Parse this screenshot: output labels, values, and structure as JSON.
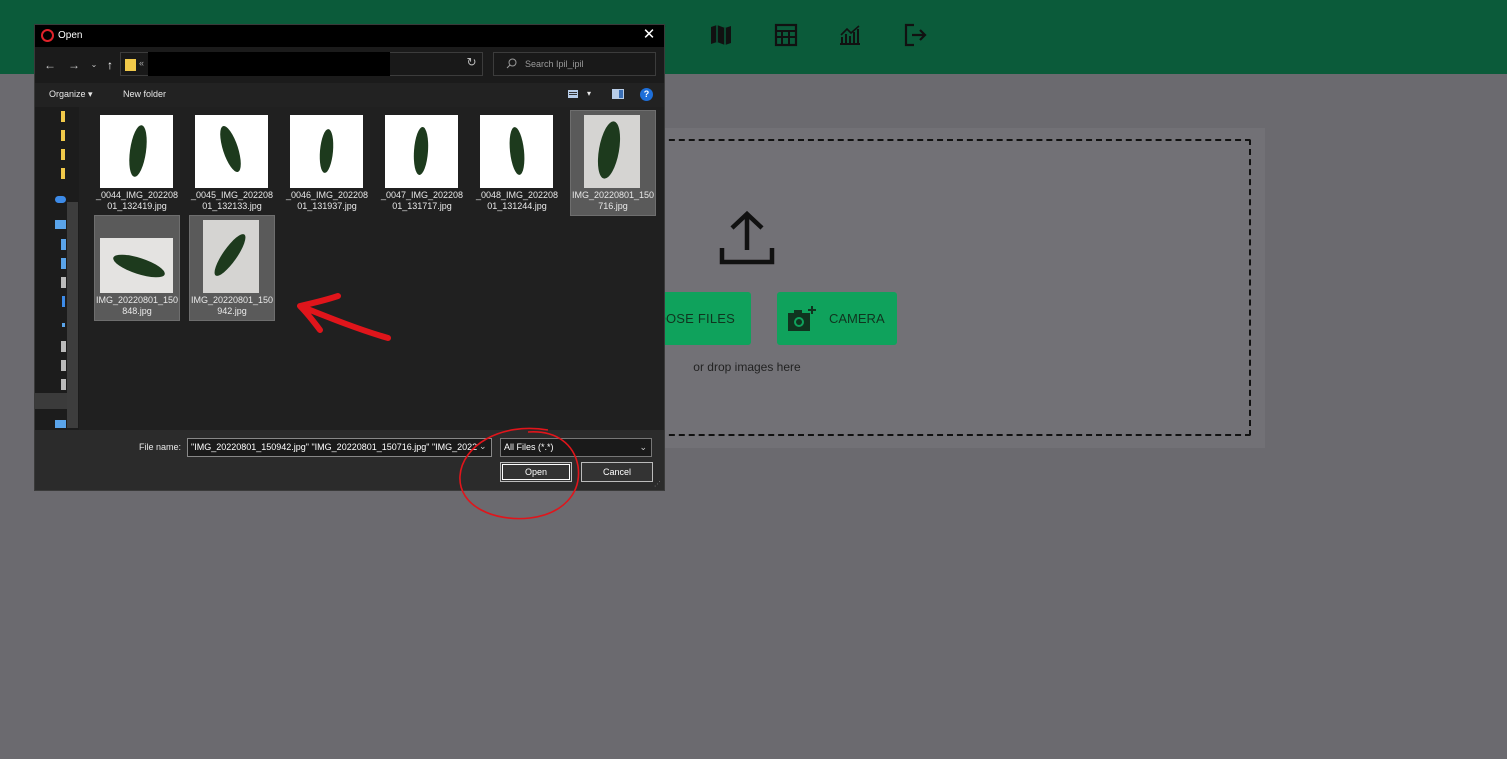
{
  "header": {
    "icons": [
      "location-icon",
      "map-icon",
      "table-icon",
      "chart-icon",
      "logout-icon"
    ]
  },
  "upload": {
    "choose_files_label": "OOSE FILES",
    "camera_label": "CAMERA",
    "drop_hint": "or drop images here"
  },
  "dialog": {
    "title": "Open",
    "close": "✕",
    "path_prefix": "«",
    "search_placeholder": "Search Ipil_ipil",
    "organize_label": "Organize",
    "new_folder_label": "New folder",
    "help": "?",
    "files": [
      {
        "name": "_0044_IMG_20220801_132419.jpg",
        "selected": false
      },
      {
        "name": "_0045_IMG_20220801_132133.jpg",
        "selected": false
      },
      {
        "name": "_0046_IMG_20220801_131937.jpg",
        "selected": false
      },
      {
        "name": "_0047_IMG_20220801_131717.jpg",
        "selected": false
      },
      {
        "name": "_0048_IMG_20220801_131244.jpg",
        "selected": false
      },
      {
        "name": "IMG_20220801_150716.jpg",
        "selected": true
      },
      {
        "name": "IMG_20220801_150848.jpg",
        "selected": true
      },
      {
        "name": "IMG_20220801_150942.jpg",
        "selected": true
      }
    ],
    "file_name_label": "File name:",
    "file_name_value": "\"IMG_20220801_150942.jpg\" \"IMG_20220801_150716.jpg\" \"IMG_2022",
    "file_type_value": "All Files (*.*)",
    "open_label": "Open",
    "cancel_label": "Cancel"
  },
  "colors": {
    "header": "#0b5b3a",
    "button": "#0fa25c",
    "annotation": "#e0151b",
    "dialog_bg": "#202020"
  }
}
